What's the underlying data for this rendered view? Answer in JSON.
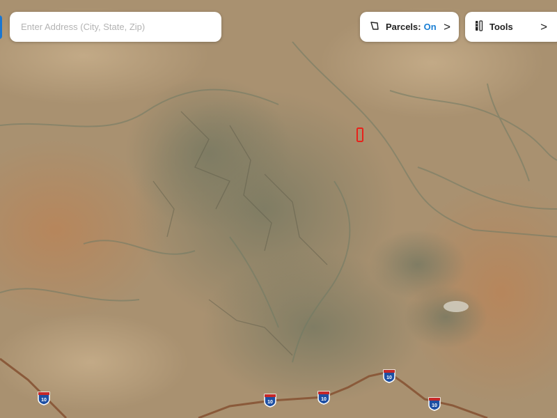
{
  "search": {
    "placeholder": "Enter Address (City, State, Zip)"
  },
  "parcels": {
    "label": "Parcels:",
    "state": "On",
    "icon": "parcel-shape-icon",
    "chevron": ">"
  },
  "tools": {
    "label": "Tools",
    "icon": "tools-icon",
    "chevron": ">"
  },
  "highway": {
    "route": "10",
    "color": "#8a5a3a"
  },
  "highlight": {
    "color": "#e8211a"
  }
}
